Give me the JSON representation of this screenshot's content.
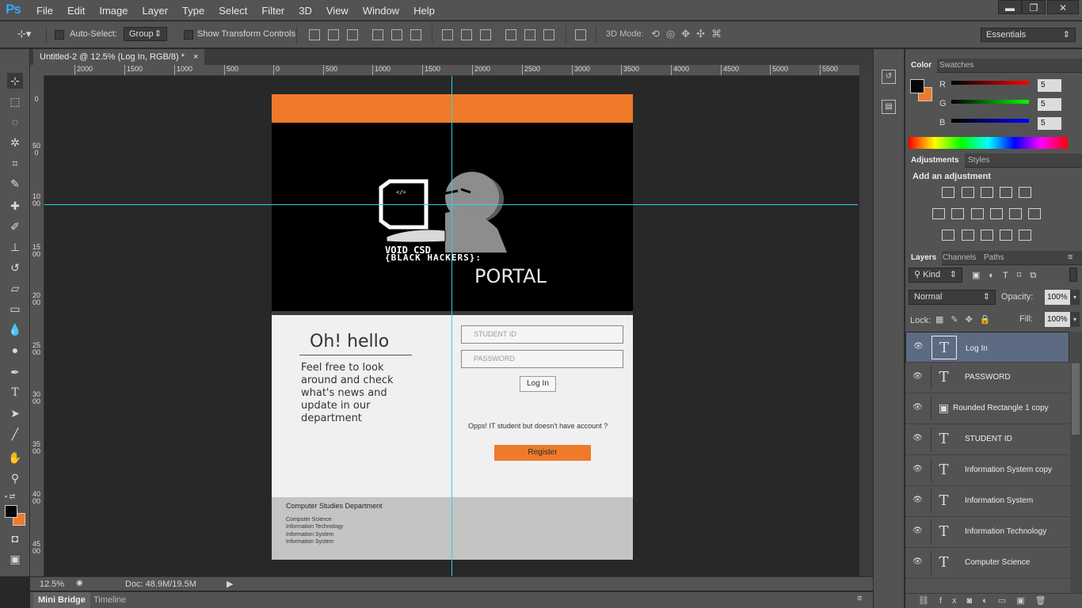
{
  "app": {
    "logo": "Ps"
  },
  "menu": [
    "File",
    "Edit",
    "Image",
    "Layer",
    "Type",
    "Select",
    "Filter",
    "3D",
    "View",
    "Window",
    "Help"
  ],
  "window_controls": {
    "minimize": "▬",
    "restore": "❐",
    "close": "✕"
  },
  "options": {
    "auto_select_label": "Auto-Select:",
    "group_value": "Group",
    "show_transform_label": "Show Transform Controls",
    "mode_3d_label": "3D Mode:",
    "workspace": "Essentials"
  },
  "document_tab": {
    "title": "Untitled-2 @ 12.5% (Log In, RGB/8) *",
    "close": "×"
  },
  "ruler": {
    "h": [
      "2000",
      "1500",
      "1000",
      "500",
      "0",
      "500",
      "1000",
      "1500",
      "2000",
      "2500",
      "3000",
      "3500",
      "4000",
      "4500",
      "5000",
      "5500"
    ],
    "v": [
      "0",
      "500",
      "1000",
      "1500",
      "2000",
      "2500",
      "3000",
      "3500",
      "4000",
      "4500"
    ]
  },
  "design": {
    "brand_line1": "VOID CSD",
    "brand_line2": "{BLACK HACKERS}:",
    "portal": "PORTAL",
    "hello": "Oh! hello",
    "welcome": "Feel free to look around and check what's news and update in our department",
    "student_id_placeholder": "STUDENT ID",
    "password_placeholder": "PASSWORD",
    "login_button": "Log In",
    "opps_text": "Opps! IT student but doesn't have account ?",
    "register_button": "Register",
    "footer_title": "Computer Studies Department",
    "footer_items": [
      "Computer Science",
      "Information Technology",
      "Information  System",
      "Information  System"
    ]
  },
  "status": {
    "zoom": "12.5%",
    "doc_size": "Doc: 48.9M/19.5M"
  },
  "bottom_tabs": [
    "Mini Bridge",
    "Timeline"
  ],
  "color_panel": {
    "tabs": [
      "Color",
      "Swatches"
    ],
    "labels": [
      "R",
      "G",
      "B"
    ],
    "values": [
      "5",
      "5",
      "5"
    ],
    "foreground": "#050505",
    "background": "#ef7a2a"
  },
  "adjustments_panel": {
    "tabs": [
      "Adjustments",
      "Styles"
    ],
    "heading": "Add an adjustment"
  },
  "layers_panel": {
    "tabs": [
      "Layers",
      "Channels",
      "Paths"
    ],
    "kind_label": "Kind",
    "blend_mode": "Normal",
    "opacity_label": "Opacity:",
    "opacity_value": "100%",
    "lock_label": "Lock:",
    "fill_label": "Fill:",
    "fill_value": "100%",
    "layers": [
      {
        "name": "Log In",
        "type": "T",
        "selected": true
      },
      {
        "name": "PASSWORD",
        "type": "T"
      },
      {
        "name": "Rounded Rectangle 1 copy",
        "type": "shape"
      },
      {
        "name": "STUDENT ID",
        "type": "T"
      },
      {
        "name": "Information  System copy",
        "type": "T"
      },
      {
        "name": "Information  System",
        "type": "T"
      },
      {
        "name": "Information Technology",
        "type": "T"
      },
      {
        "name": "Computer Science",
        "type": "T"
      }
    ]
  },
  "colors": {
    "orange": "#ef7a2a",
    "guide": "#2ad4e4",
    "ui_gray": "#535353",
    "selected_layer": "#5c6b82"
  }
}
